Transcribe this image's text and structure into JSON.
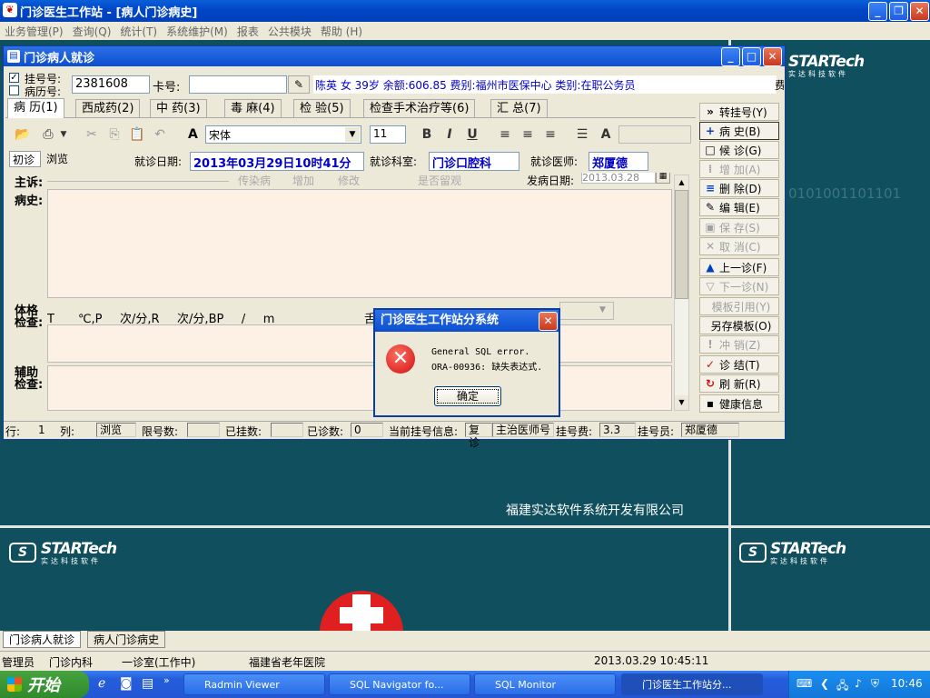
{
  "app": {
    "title": "门诊医生工作站 - [病人门诊病史]"
  },
  "menu": [
    "业务管理(P)",
    "查询(Q)",
    "统计(T)",
    "系统维护(M)",
    "报表",
    "公共模块",
    "帮助 (H)"
  ],
  "desktop": {
    "company": "福建实达软件系统开发有限公司",
    "logo_text": "STARTech",
    "logo_sub": "实达科技软件",
    "binary_text": "0101001101101"
  },
  "child": {
    "title": "门诊病人就诊",
    "reg_check_label": "挂号号:",
    "hist_check_label": "病历号:",
    "reg_no": "2381608",
    "card_label": "卡号:",
    "card_value": "",
    "patient_info": "陈英 女 39岁 余额:606.85 费别:福州市医保中心 类别:在职公务员",
    "patient_info_tail": "费",
    "tabs": [
      "病 历(1)",
      "西成药(2)",
      "中 药(3)",
      "毒 麻(4)",
      "检 验(5)",
      "检查手术治疗等(6)",
      "汇 总(7)"
    ],
    "font_name": "宋体",
    "font_size": "11",
    "subtabs": [
      "初诊",
      "浏览"
    ],
    "visit_date_label": "就诊日期:",
    "visit_date": "2013年03月29日10时41分",
    "dept_label": "就诊科室:",
    "dept": "门诊口腔科",
    "doctor_label": "就诊医师:",
    "doctor": "郑厦德",
    "chief_label": "主诉:",
    "chief_faded": [
      "传染病",
      "增加",
      "修改",
      "是否留观"
    ],
    "onset_label": "发病日期:",
    "onset_date": "2013.03.28",
    "history_label": "病史:",
    "exam_label": "体格检查:",
    "exam_template": "T____℃,P___次/分,R___次/分,BP___/___m",
    "exam_tail": "舌",
    "aux_label": "辅助检查:",
    "right_buttons": [
      {
        "label": "转挂号(Y)",
        "icon": "»"
      },
      {
        "label": "病 史(B)",
        "icon": "+"
      },
      {
        "label": "候 诊(G)",
        "icon": "□"
      },
      {
        "label": "增 加(A)",
        "icon": "⁞"
      },
      {
        "label": "删 除(D)",
        "icon": "≡"
      },
      {
        "label": "编 辑(E)",
        "icon": "✎"
      },
      {
        "label": "保 存(S)",
        "icon": "▣"
      },
      {
        "label": "取 消(C)",
        "icon": "✕"
      },
      {
        "label": "上一诊(F)",
        "icon": "▲"
      },
      {
        "label": "下一诊(N)",
        "icon": "▽"
      },
      {
        "label": "模板引用(Y)",
        "icon": ""
      },
      {
        "label": "另存模板(O)",
        "icon": ""
      },
      {
        "label": "冲 销(Z)",
        "icon": "!"
      },
      {
        "label": "诊 结(T)",
        "icon": "✓"
      },
      {
        "label": "刷 新(R)",
        "icon": "↻"
      },
      {
        "label": "健康信息",
        "icon": "▪"
      }
    ],
    "status": {
      "row_label": "行:",
      "row": "1",
      "col_label": "列:",
      "mode": "浏览",
      "limit_label": "限号数:",
      "reg_label": "已挂数:",
      "done_label": "已诊数:",
      "done": "0",
      "current_label": "当前挂号信息:",
      "visit_type": "复诊",
      "doctor_type": "主治医师号",
      "fee_label": "挂号费:",
      "fee": "3.3",
      "registrar_label": "挂号员:",
      "registrar": "郑厦德"
    }
  },
  "dialog": {
    "title": "门诊医生工作站分系统",
    "line1": "General SQL error.",
    "line2": "ORA-00936: 缺失表达式.",
    "ok": "确定"
  },
  "bottom_tabs": [
    "门诊病人就诊",
    "病人门诊病史"
  ],
  "statusbar": {
    "user": "管理员",
    "dept": "门诊内科",
    "room": "一诊室(工作中)",
    "hospital": "福建省老年医院",
    "datetime": "2013.03.29 10:45:11"
  },
  "taskbar": {
    "start": "开始",
    "buttons": [
      "Radmin Viewer",
      "SQL Navigator fo...",
      "SQL Monitor",
      "门诊医生工作站分..."
    ],
    "time": "10:46"
  },
  "colors": {
    "title_blue": "#0046c8",
    "desktop": "#0f4f5e",
    "accent_blue": "#0000c8",
    "error_red": "#d01010"
  }
}
